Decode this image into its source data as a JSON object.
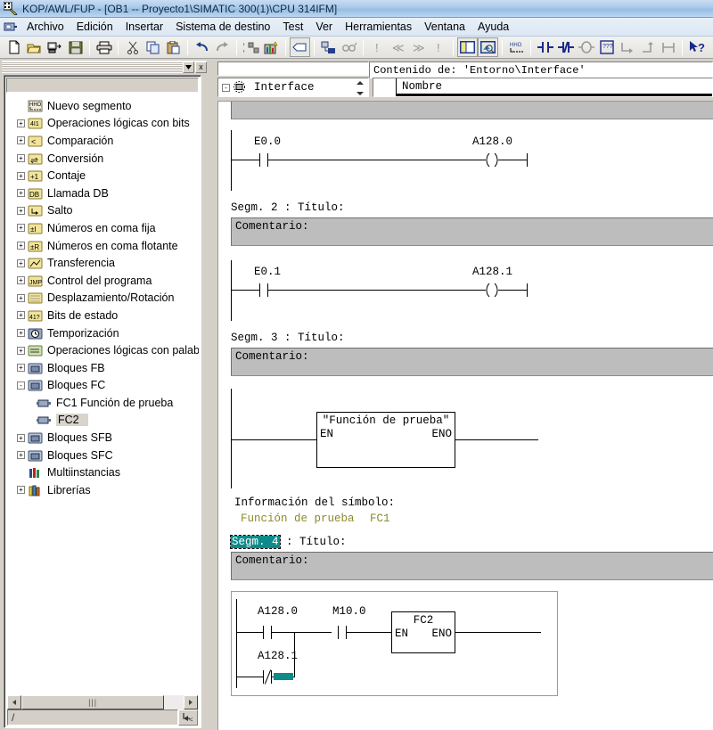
{
  "window": {
    "title": "KOP/AWL/FUP  - [OB1 -- Proyecto1\\SIMATIC 300(1)\\CPU 314IFM]",
    "app_icon": "simatic-ladder-icon",
    "menu_icon": "window-system-menu-icon"
  },
  "menubar": {
    "items": [
      {
        "label": "Archivo",
        "name": "menu-archivo"
      },
      {
        "label": "Edición",
        "name": "menu-edicion"
      },
      {
        "label": "Insertar",
        "name": "menu-insertar"
      },
      {
        "label": "Sistema de destino",
        "name": "menu-sistema-destino"
      },
      {
        "label": "Test",
        "name": "menu-test"
      },
      {
        "label": "Ver",
        "name": "menu-ver"
      },
      {
        "label": "Herramientas",
        "name": "menu-herramientas"
      },
      {
        "label": "Ventana",
        "name": "menu-ventana"
      },
      {
        "label": "Ayuda",
        "name": "menu-ayuda"
      }
    ]
  },
  "toolbar": {
    "buttons": [
      {
        "name": "new-icon",
        "tip": "Nuevo"
      },
      {
        "name": "open-folder-icon",
        "tip": "Abrir"
      },
      {
        "name": "online-offline-icon",
        "tip": "Online/Offline"
      },
      {
        "name": "save-icon",
        "tip": "Guardar"
      },
      {
        "name": "print-icon",
        "tip": "Imprimir"
      },
      {
        "name": "cut-icon",
        "tip": "Cortar"
      },
      {
        "name": "copy-icon",
        "tip": "Copiar"
      },
      {
        "name": "paste-icon",
        "tip": "Pegar"
      },
      {
        "name": "undo-icon",
        "tip": "Deshacer"
      },
      {
        "name": "redo-icon",
        "tip": "Rehacer"
      },
      {
        "name": "download-plc-icon",
        "tip": "Cargar"
      },
      {
        "name": "monitor-chart-icon",
        "tip": "Observar"
      },
      {
        "name": "symbol-table-icon",
        "tip": "Tabla de símbolos"
      },
      {
        "name": "network-node-icon",
        "tip": "Red"
      },
      {
        "name": "glasses-icon",
        "tip": "Modo observación"
      },
      {
        "name": "first-error-icon",
        "tip": "Primer error"
      },
      {
        "name": "prev-error-icon",
        "tip": "Error anterior"
      },
      {
        "name": "next-error-icon",
        "tip": "Error siguiente"
      },
      {
        "name": "last-error-icon",
        "tip": "Último error"
      },
      {
        "name": "toggle-overview-icon",
        "tip": "Vista general"
      },
      {
        "name": "toggle-details-icon",
        "tip": "Detalles"
      },
      {
        "name": "new-network-icon",
        "tip": "Nuevo segmento"
      },
      {
        "name": "normally-open-contact-icon",
        "tip": "Contacto normalmente abierto"
      },
      {
        "name": "normally-closed-contact-icon",
        "tip": "Contacto normalmente cerrado"
      },
      {
        "name": "coil-icon",
        "tip": "Bobina"
      },
      {
        "name": "empty-box-icon",
        "tip": "Cuadro vacío"
      },
      {
        "name": "branch-open-icon",
        "tip": "Abrir rama"
      },
      {
        "name": "branch-close-icon",
        "tip": "Cerrar rama"
      },
      {
        "name": "branch-connect-icon",
        "tip": "Conectar rama"
      },
      {
        "name": "help-pointer-icon",
        "tip": "Ayuda contextual"
      }
    ]
  },
  "left_panel": {
    "titlebar": {
      "dropdown_icon": "chevron-down-icon",
      "close_icon": "close-icon",
      "close_label": "x"
    },
    "tree": [
      {
        "label": "Nuevo segmento",
        "icon": "new-network-icon",
        "expander": "none",
        "indent": 0,
        "selected": false
      },
      {
        "label": "Operaciones lógicas con bits",
        "icon": "folder-bitlogic-icon",
        "expander": "+",
        "indent": 0,
        "selected": false
      },
      {
        "label": "Comparación",
        "icon": "folder-compare-icon",
        "expander": "+",
        "indent": 0,
        "selected": false
      },
      {
        "label": "Conversión",
        "icon": "folder-convert-icon",
        "expander": "+",
        "indent": 0,
        "selected": false
      },
      {
        "label": "Contaje",
        "icon": "folder-counter-icon",
        "expander": "+",
        "indent": 0,
        "selected": false
      },
      {
        "label": "Llamada DB",
        "icon": "folder-db-icon",
        "expander": "+",
        "indent": 0,
        "selected": false
      },
      {
        "label": "Salto",
        "icon": "folder-jump-icon",
        "expander": "+",
        "indent": 0,
        "selected": false
      },
      {
        "label": "Números en coma fija",
        "icon": "folder-int-icon",
        "expander": "+",
        "indent": 0,
        "selected": false
      },
      {
        "label": "Números en coma flotante",
        "icon": "folder-real-icon",
        "expander": "+",
        "indent": 0,
        "selected": false
      },
      {
        "label": "Transferencia",
        "icon": "folder-move-icon",
        "expander": "+",
        "indent": 0,
        "selected": false
      },
      {
        "label": "Control del programa",
        "icon": "folder-control-icon",
        "expander": "+",
        "indent": 0,
        "selected": false
      },
      {
        "label": "Desplazamiento/Rotación",
        "icon": "folder-shift-icon",
        "expander": "+",
        "indent": 0,
        "selected": false
      },
      {
        "label": "Bits de estado",
        "icon": "folder-status-icon",
        "expander": "+",
        "indent": 0,
        "selected": false
      },
      {
        "label": "Temporización",
        "icon": "folder-timer-icon",
        "expander": "+",
        "indent": 0,
        "selected": false
      },
      {
        "label": "Operaciones lógicas con palabra",
        "icon": "folder-wordlogic-icon",
        "expander": "+",
        "indent": 0,
        "selected": false
      },
      {
        "label": "Bloques FB",
        "icon": "folder-block-icon",
        "expander": "+",
        "indent": 0,
        "selected": false
      },
      {
        "label": "Bloques FC",
        "icon": "folder-block-icon",
        "expander": "-",
        "indent": 0,
        "selected": false
      },
      {
        "label": "FC1   Función de prueba",
        "icon": "block-fc-icon",
        "expander": "none",
        "indent": 1,
        "selected": false
      },
      {
        "label": "FC2",
        "icon": "block-fc-icon",
        "expander": "none",
        "indent": 1,
        "selected": true
      },
      {
        "label": "Bloques SFB",
        "icon": "folder-block-icon",
        "expander": "+",
        "indent": 0,
        "selected": false
      },
      {
        "label": "Bloques SFC",
        "icon": "folder-block-icon",
        "expander": "+",
        "indent": 0,
        "selected": false
      },
      {
        "label": "Multiinstancias",
        "icon": "multiinstance-icon",
        "expander": "none",
        "indent": 0,
        "selected": false
      },
      {
        "label": "Librerías",
        "icon": "library-icon",
        "expander": "+",
        "indent": 0,
        "selected": false
      }
    ],
    "hscroll": {
      "thumb_glyph": "|||",
      "left_arrow": "◄",
      "right_arrow": "►"
    },
    "status": {
      "path": "/",
      "corner_icon": "resize-grip-icon"
    }
  },
  "editor": {
    "interface": {
      "tree_label": "Interface",
      "tree_expander": "-",
      "tree_icon": "interface-node-icon",
      "content_title": "Contenido de: 'Entorno\\Interface'",
      "grid_header_name": "Nombre",
      "spinner_icon": "spinner-up-down-icon"
    },
    "networks": [
      {
        "id": "segm1",
        "title": null,
        "comment": "",
        "highlighted": false,
        "rung": {
          "contacts": [
            {
              "label": "E0.0",
              "type": "no"
            }
          ],
          "output": {
            "label": "A128.0",
            "type": "coil"
          }
        }
      },
      {
        "id": "segm2",
        "title": "Segm. 2 : Título:",
        "title_prefix": "Segm. 2",
        "title_suffix": " : Título:",
        "comment": "Comentario:",
        "highlighted": false,
        "rung": {
          "contacts": [
            {
              "label": "E0.1",
              "type": "no"
            }
          ],
          "output": {
            "label": "A128.1",
            "type": "coil"
          }
        }
      },
      {
        "id": "segm3",
        "title": "Segm. 3 : Título:",
        "title_prefix": "Segm. 3",
        "title_suffix": " : Título:",
        "comment": "Comentario:",
        "highlighted": false,
        "rung": {
          "contacts": [],
          "box": {
            "name": "\"Función de prueba\"",
            "en": "EN",
            "eno": "ENO"
          }
        }
      },
      {
        "id": "segm4",
        "title_prefix": "Segm. 4",
        "title_suffix": " : Título:",
        "comment": "Comentario:",
        "highlighted": true,
        "rung": {
          "contacts": [
            {
              "label": "A128.0",
              "type": "no"
            },
            {
              "label": "A128.1",
              "type": "nc"
            },
            {
              "label": "M10.0",
              "type": "no"
            }
          ],
          "box": {
            "name": "FC2",
            "en": "EN",
            "eno": "ENO"
          }
        }
      }
    ],
    "symbol_info": {
      "heading": "Información del símbolo:",
      "symbol_name": "Función de prueba",
      "symbol_address": "FC1"
    }
  },
  "colors": {
    "selection_teal": "#0f8a8a",
    "comment_bar": "#bdbdbd",
    "symbol_text": "#8a8a2a",
    "window_face": "#d4d0c8",
    "title_gradient_start": "#c9ddf2",
    "title_gradient_end": "#97bde4",
    "contact_blue": "#000080"
  }
}
